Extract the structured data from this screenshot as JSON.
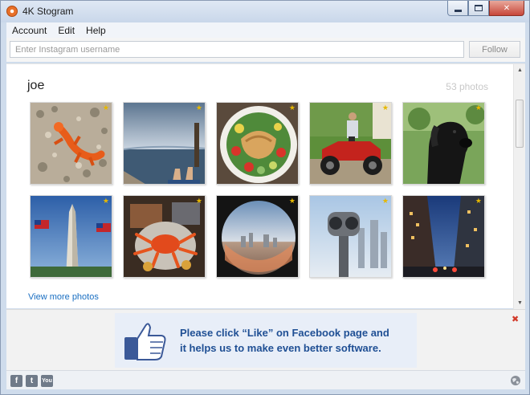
{
  "window": {
    "title": "4K Stogram"
  },
  "menu": {
    "items": [
      "Account",
      "Edit",
      "Help"
    ]
  },
  "search": {
    "placeholder": "Enter Instagram username",
    "value": "",
    "follow_label": "Follow"
  },
  "profile": {
    "username": "joe",
    "photo_count": "53 photos"
  },
  "photos": [
    {
      "subject": "orange lizard on pebbles",
      "icon": "star-icon"
    },
    {
      "subject": "feet on dock over lake",
      "icon": "star-icon"
    },
    {
      "subject": "salad bowl with chicken",
      "icon": "star-icon"
    },
    {
      "subject": "man on red ATV",
      "icon": "star-icon"
    },
    {
      "subject": "black dog",
      "icon": "star-icon"
    },
    {
      "subject": "Washington Monument with flags",
      "icon": "star-icon"
    },
    {
      "subject": "crab on plate",
      "icon": "star-icon"
    },
    {
      "subject": "city fisheye view",
      "icon": "star-icon"
    },
    {
      "subject": "coin-operated binoculars",
      "icon": "star-icon"
    },
    {
      "subject": "city street at dusk",
      "icon": "star-icon"
    }
  ],
  "view_more_label": "View more photos",
  "ad": {
    "line1": "Please click “Like” on Facebook page and",
    "line2": "it helps us to make even better software."
  },
  "social": {
    "facebook": "f",
    "twitter": "t",
    "youtube": "You"
  },
  "colors": {
    "accent": "#1a6fc2",
    "ad_text": "#1f4f94",
    "close": "#d23a2a"
  }
}
